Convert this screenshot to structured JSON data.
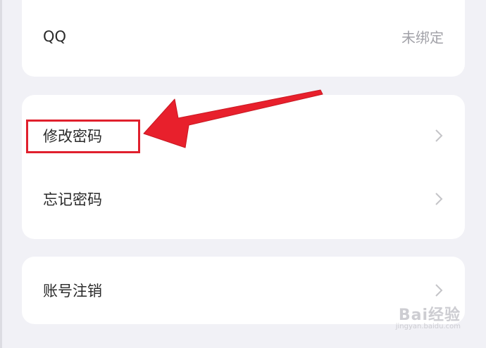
{
  "accounts": {
    "qq": {
      "label": "QQ",
      "value": "未绑定"
    }
  },
  "security": {
    "change_password": {
      "label": "修改密码"
    },
    "forgot_password": {
      "label": "忘记密码"
    }
  },
  "account": {
    "deactivate": {
      "label": "账号注销"
    }
  },
  "annotation": {
    "color": "#e0202d"
  },
  "watermark": {
    "text": "Bai经验",
    "sub": "jingyan.baidu.com"
  },
  "colors": {
    "background": "#f1f1f6",
    "card": "#ffffff",
    "label": "#2a2a2a",
    "secondary": "#a2a2a8"
  }
}
